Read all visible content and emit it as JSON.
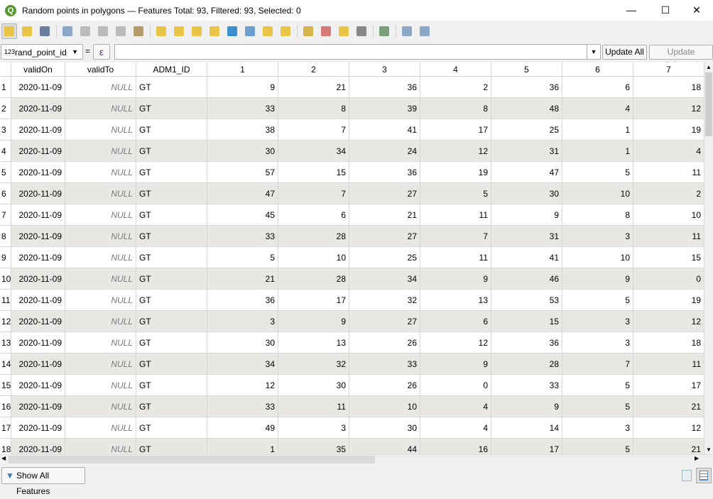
{
  "window": {
    "title": "Random points in polygons — Features Total: 93, Filtered: 93, Selected: 0",
    "minimize": "—",
    "maximize": "☐",
    "close": "✕"
  },
  "toolbar": {
    "icons": [
      "toggle-editing",
      "multi-edit",
      "save-edits",
      "add-feature",
      "delete-features",
      "cut",
      "copy",
      "paste",
      "select-by-expression",
      "select-all",
      "invert-selection",
      "deselect-all",
      "filter-selected",
      "move-selection-top",
      "pan-to-selected",
      "zoom-to-selected",
      "new-field",
      "delete-field",
      "field-calculator",
      "conditional-formatting",
      "actions",
      "dock-table",
      "organize-columns"
    ]
  },
  "filter": {
    "field_type": "123",
    "field": "rand_point_id",
    "equals": "=",
    "expression_icon": "ε",
    "value": "",
    "update_all": "Update All",
    "update_selected": "Update Selected"
  },
  "table": {
    "columns": [
      "validOn",
      "validTo",
      "ADM1_ID",
      "1",
      "2",
      "3",
      "4",
      "5",
      "6",
      "7"
    ],
    "rows": [
      [
        "1",
        "2020-11-09",
        "NULL",
        "GT",
        "9",
        "21",
        "36",
        "2",
        "36",
        "6",
        "18"
      ],
      [
        "2",
        "2020-11-09",
        "NULL",
        "GT",
        "33",
        "8",
        "39",
        "8",
        "48",
        "4",
        "12"
      ],
      [
        "3",
        "2020-11-09",
        "NULL",
        "GT",
        "38",
        "7",
        "41",
        "17",
        "25",
        "1",
        "19"
      ],
      [
        "4",
        "2020-11-09",
        "NULL",
        "GT",
        "30",
        "34",
        "24",
        "12",
        "31",
        "1",
        "4"
      ],
      [
        "5",
        "2020-11-09",
        "NULL",
        "GT",
        "57",
        "15",
        "36",
        "19",
        "47",
        "5",
        "11"
      ],
      [
        "6",
        "2020-11-09",
        "NULL",
        "GT",
        "47",
        "7",
        "27",
        "5",
        "30",
        "10",
        "2"
      ],
      [
        "7",
        "2020-11-09",
        "NULL",
        "GT",
        "45",
        "6",
        "21",
        "11",
        "9",
        "8",
        "10"
      ],
      [
        "8",
        "2020-11-09",
        "NULL",
        "GT",
        "33",
        "28",
        "27",
        "7",
        "31",
        "3",
        "11"
      ],
      [
        "9",
        "2020-11-09",
        "NULL",
        "GT",
        "5",
        "10",
        "25",
        "11",
        "41",
        "10",
        "15"
      ],
      [
        "10",
        "2020-11-09",
        "NULL",
        "GT",
        "21",
        "28",
        "34",
        "9",
        "46",
        "9",
        "0"
      ],
      [
        "11",
        "2020-11-09",
        "NULL",
        "GT",
        "36",
        "17",
        "32",
        "13",
        "53",
        "5",
        "19"
      ],
      [
        "12",
        "2020-11-09",
        "NULL",
        "GT",
        "3",
        "9",
        "27",
        "6",
        "15",
        "3",
        "12"
      ],
      [
        "13",
        "2020-11-09",
        "NULL",
        "GT",
        "30",
        "13",
        "26",
        "12",
        "36",
        "3",
        "18"
      ],
      [
        "14",
        "2020-11-09",
        "NULL",
        "GT",
        "34",
        "32",
        "33",
        "9",
        "28",
        "7",
        "11"
      ],
      [
        "15",
        "2020-11-09",
        "NULL",
        "GT",
        "12",
        "30",
        "26",
        "0",
        "33",
        "5",
        "17"
      ],
      [
        "16",
        "2020-11-09",
        "NULL",
        "GT",
        "33",
        "11",
        "10",
        "4",
        "9",
        "5",
        "21"
      ],
      [
        "17",
        "2020-11-09",
        "NULL",
        "GT",
        "49",
        "3",
        "30",
        "4",
        "14",
        "3",
        "12"
      ],
      [
        "18",
        "2020-11-09",
        "NULL",
        "GT",
        "1",
        "35",
        "44",
        "16",
        "17",
        "5",
        "21"
      ]
    ]
  },
  "statusbar": {
    "show_all": "Show All Features"
  },
  "colors": {
    "alt_row": "#e9e7e3",
    "null_text": "#7a7a7a",
    "expression": "#6b2d84"
  }
}
